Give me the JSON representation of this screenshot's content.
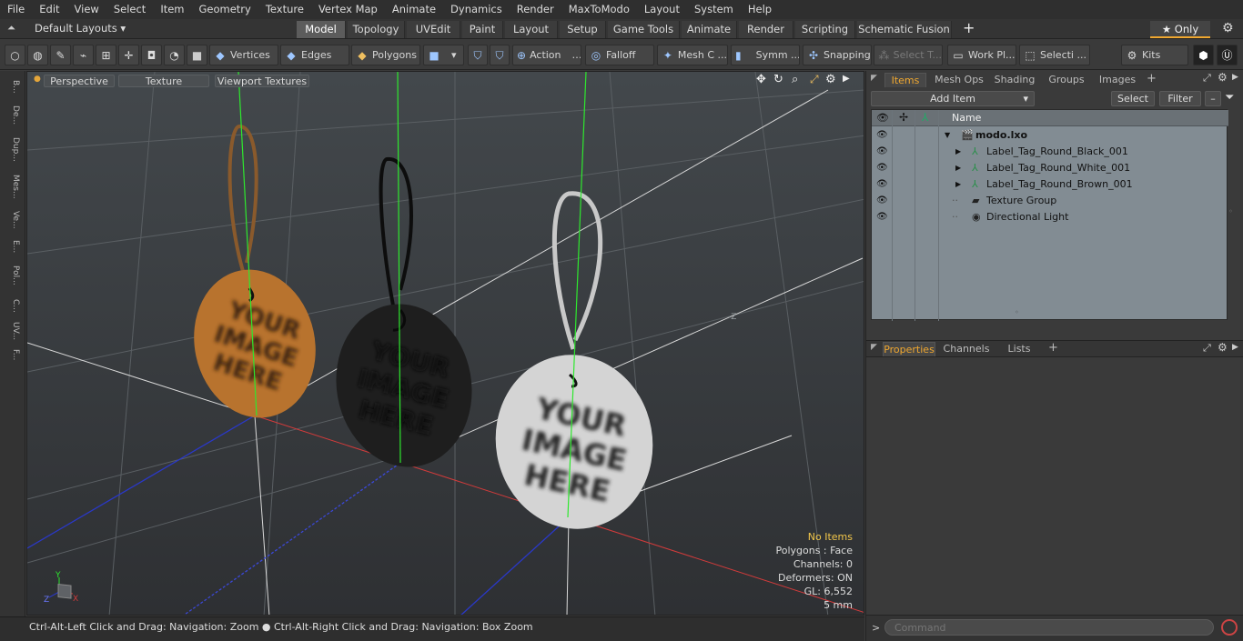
{
  "menu": [
    "File",
    "Edit",
    "View",
    "Select",
    "Item",
    "Geometry",
    "Texture",
    "Vertex Map",
    "Animate",
    "Dynamics",
    "Render",
    "MaxToModo",
    "Layout",
    "System",
    "Help"
  ],
  "layout_bar": {
    "layout_label": "Default Layouts ▾",
    "tabs": [
      "Model",
      "Topology",
      "UVEdit",
      "Paint",
      "Layout",
      "Setup",
      "Game Tools",
      "Animate",
      "Render",
      "Scripting",
      "Schematic Fusion"
    ],
    "active_tab": "Model",
    "add": "+",
    "only_label": "★ Only",
    "gear": "⚙"
  },
  "toolbar": {
    "vertices": "Vertices",
    "edges": "Edges",
    "polygons": "Polygons",
    "action": "Action",
    "falloff": "Falloff",
    "mesh": "Mesh C ...",
    "symm": "Symm ...",
    "snapping": "Snapping",
    "select_t": "Select T...",
    "work_pl": "Work Pl...",
    "selecti": "Selecti ...",
    "kits": "Kits"
  },
  "left_strip": [
    "B...",
    "De...",
    "Dup...",
    "Mes...",
    "Ve...",
    "E...",
    "Pol...",
    "C...",
    "UV...",
    "F..."
  ],
  "viewport": {
    "perspective": "Perspective",
    "texture": "Texture",
    "viewport_textures": "Viewport Textures",
    "axis_label": "-Z",
    "tag_text": [
      "YOUR",
      "IMAGE",
      "HERE"
    ],
    "info": {
      "no_items": "No Items",
      "polygons": "Polygons : Face",
      "channels": "Channels: 0",
      "deformers": "Deformers: ON",
      "gl": "GL: 6,552",
      "scale": "5 mm"
    }
  },
  "status_bar": "Ctrl-Alt-Left Click and Drag: Navigation: Zoom ● Ctrl-Alt-Right Click and Drag: Navigation: Box Zoom",
  "items_panel": {
    "tabs": [
      "Items",
      "Mesh Ops",
      "Shading",
      "Groups",
      "Images"
    ],
    "active_tab": "Items",
    "add_item": "Add Item",
    "select": "Select",
    "filter": "Filter",
    "column_name": "Name",
    "rows": [
      {
        "label": "modo.lxo",
        "bold": true
      },
      {
        "label": "Label_Tag_Round_Black_001"
      },
      {
        "label": "Label_Tag_Round_White_001"
      },
      {
        "label": "Label_Tag_Round_Brown_001"
      },
      {
        "label": "Texture Group"
      },
      {
        "label": "Directional Light"
      }
    ]
  },
  "properties_panel": {
    "tabs": [
      "Properties",
      "Channels",
      "Lists"
    ],
    "active_tab": "Properties",
    "command_placeholder": "Command"
  },
  "colors": {
    "accent": "#f0a830",
    "brown_tag": "#b8732e",
    "black_tag": "#1a1a1a",
    "white_tag": "#d4d4d4",
    "green_axis": "#2ee82e",
    "red_axis": "#d23b3b",
    "blue_axis": "#2a38c8"
  }
}
